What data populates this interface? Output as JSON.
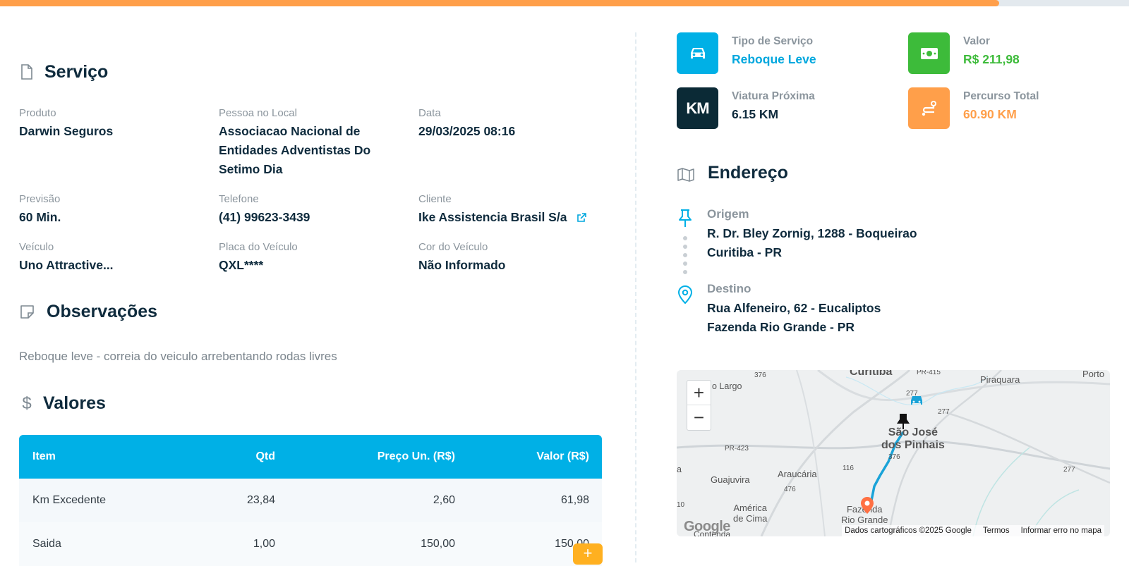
{
  "progress": {
    "fraction": 0.885,
    "color": "#ff9f4a"
  },
  "servico": {
    "title": "Serviço",
    "fields": {
      "produto_label": "Produto",
      "produto_value": "Darwin Seguros",
      "pessoa_label": "Pessoa no Local",
      "pessoa_value_1": "Associacao Nacional de",
      "pessoa_value_2": "Entidades Adventistas Do",
      "pessoa_value_3": "Setimo Dia",
      "data_label": "Data",
      "data_value": "29/03/2025 08:16",
      "previsao_label": "Previsão",
      "previsao_value": "60 Min.",
      "telefone_label": "Telefone",
      "telefone_value": "(41) 99623-3439",
      "cliente_label": "Cliente",
      "cliente_value": "Ike Assistencia Brasil S/a",
      "veiculo_label": "Veículo",
      "veiculo_value": "Uno Attractive...",
      "placa_label": "Placa do Veículo",
      "placa_value": "QXL****",
      "cor_label": "Cor do Veículo",
      "cor_value": "Não Informado"
    }
  },
  "observacoes": {
    "title": "Observações",
    "text": "Reboque leve - correia do veiculo arrebentando rodas livres"
  },
  "valores": {
    "title": "Valores",
    "columns": {
      "item": "Item",
      "qtd": "Qtd",
      "preco": "Preço Un. (R$)",
      "valor": "Valor (R$)"
    },
    "rows": [
      {
        "item": "Km Excedente",
        "qtd": "23,84",
        "preco": "2,60",
        "valor": "61,98"
      },
      {
        "item": "Saida",
        "qtd": "1,00",
        "preco": "150,00",
        "valor": "150,00"
      }
    ],
    "fab_label": "+"
  },
  "cards": {
    "tipo_label": "Tipo de Serviço",
    "tipo_value": "Reboque Leve",
    "tipo_icon": "car-icon",
    "tipo_color": "#00b0e6",
    "valor_label": "Valor",
    "valor_value": "R$ 211,98",
    "valor_icon": "money-icon",
    "valor_color": "#3dbb3a",
    "viatura_label": "Viatura Próxima",
    "viatura_value": "6.15 KM",
    "viatura_icon_text": "KM",
    "viatura_color": "#0b2a36",
    "percurso_label": "Percurso Total",
    "percurso_value": "60.90 KM",
    "percurso_icon": "route-icon",
    "percurso_color": "#ff9f4a"
  },
  "endereco": {
    "title": "Endereço",
    "origem_label": "Origem",
    "origem_line1": "R. Dr. Bley Zornig, 1288 - Boqueirao",
    "origem_line2": "Curitiba - PR",
    "destino_label": "Destino",
    "destino_line1": "Rua Alfeneiro, 62 - Eucaliptos",
    "destino_line2": "Fazenda Rio Grande - PR"
  },
  "map": {
    "zoom_in": "+",
    "zoom_out": "−",
    "attribution": "Dados cartográficos ©2025 Google",
    "terms": "Termos",
    "report": "Informar erro no mapa",
    "google": "Google",
    "labels": {
      "curitiba": "Curitiba",
      "largo": "o Largo",
      "pr415": "PR-415",
      "piraquara": "Piraquara",
      "porto": "Porto",
      "r376a": "376",
      "r277a": "277",
      "r277b": "277",
      "r277c": "277",
      "r376b": "376",
      "r116": "116",
      "r476": "476",
      "pr423": "PR-423",
      "r10": "10",
      "sjp_1": "São José",
      "sjp_2": "dos Pinhais",
      "guajuvira": "Guajuvira",
      "araucaria": "Araucária",
      "america_1": "América",
      "america_2": "de Cima",
      "fazenda_1": "Fazenda",
      "fazenda_2": "Rio Grande",
      "contenda": "Contenda",
      "a": "a"
    }
  }
}
